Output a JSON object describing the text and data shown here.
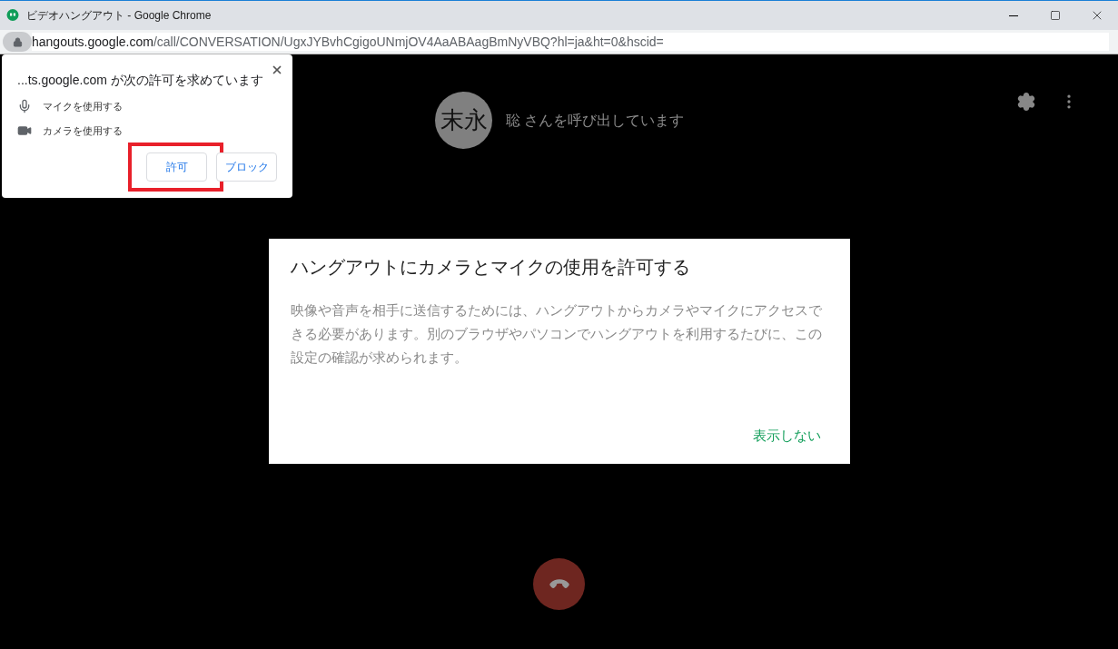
{
  "window": {
    "title": "ビデオハングアウト - Google Chrome"
  },
  "address_bar": {
    "domain": "hangouts.google.com",
    "path": "/call/CONVERSATION/UgxJYBvhCgigoUNmjOV4AaABAagBmNyVBQ?hl=ja&ht=0&hscid="
  },
  "permission_popup": {
    "title": "...ts.google.com が次の許可を求めています",
    "permissions": [
      {
        "kind": "mic",
        "label": "マイクを使用する"
      },
      {
        "kind": "camera",
        "label": "カメラを使用する"
      }
    ],
    "buttons": [
      {
        "label": "許可",
        "highlighted": true
      },
      {
        "label": "ブロック",
        "highlighted": false
      }
    ]
  },
  "call": {
    "avatar_text": "末永",
    "status": "聡 さんを呼び出しています"
  },
  "dialog": {
    "title": "ハングアウトにカメラとマイクの使用を許可する",
    "body": "映像や音声を相手に送信するためには、ハングアウトからカメラやマイクにアクセスできる必要があります。別のブラウザやパソコンでハングアウトを利用するたびに、この設定の確認が求められます。",
    "action": "表示しない"
  }
}
